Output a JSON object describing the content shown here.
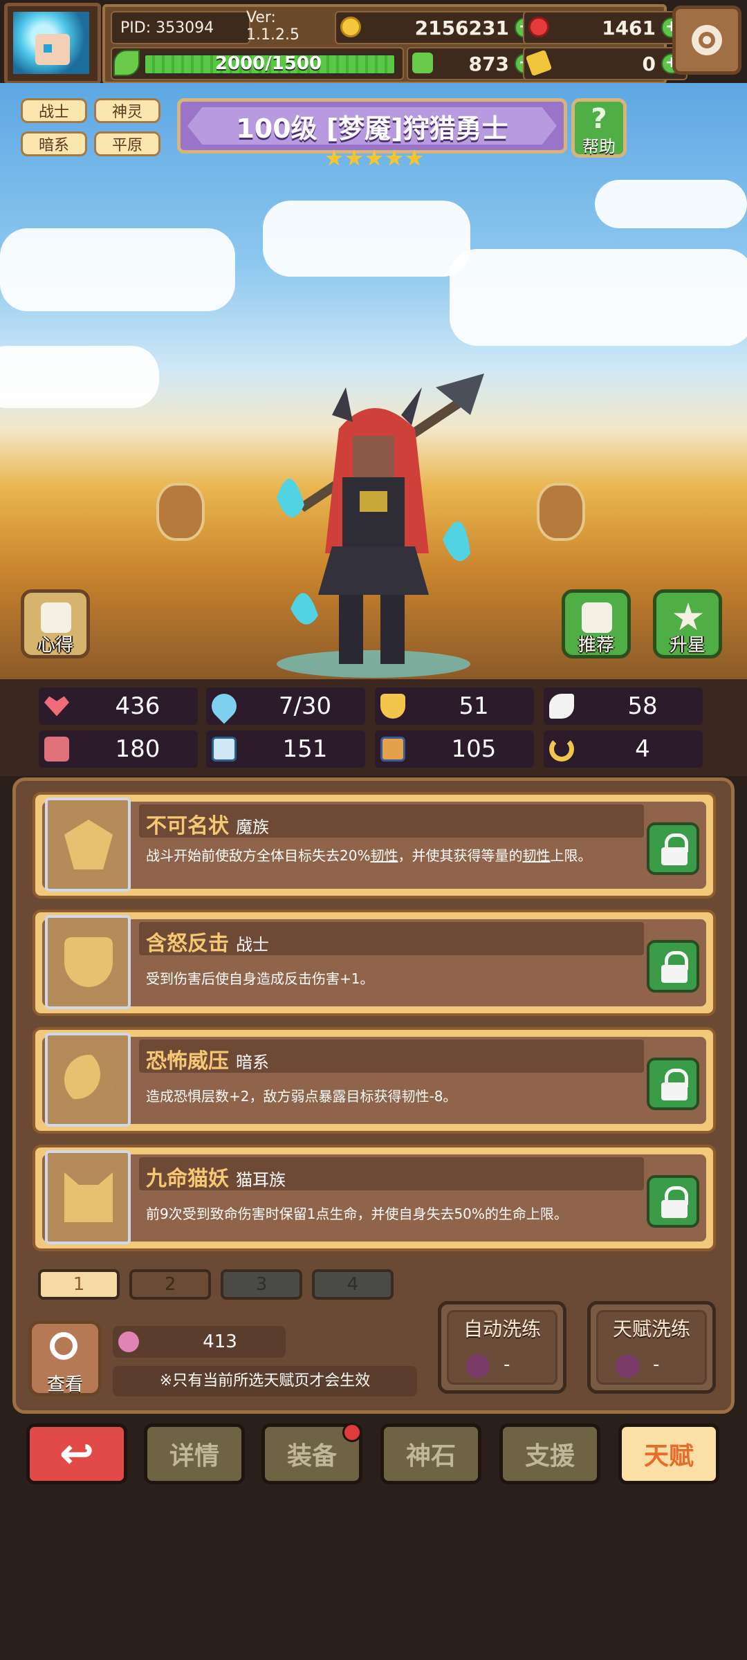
{
  "hud": {
    "pid": "PID: 353094",
    "version": "Ver: 1.1.2.5",
    "gold": "2156231",
    "gems": "1461",
    "energy": "2000/1500",
    "energy_fraction": 1.0,
    "clover": "873",
    "tickets": "0"
  },
  "tags": [
    "战士",
    "神灵",
    "暗系",
    "平原"
  ],
  "hero": {
    "title": "100级 [梦魇]狩猎勇士",
    "stars": 5
  },
  "buttons": {
    "help": "帮助",
    "notes": "心得",
    "recommend": "推荐",
    "star_up": "升星"
  },
  "stats": [
    {
      "icon": "heart-icon",
      "value": "436"
    },
    {
      "icon": "mana-drop-icon",
      "value": "7/30"
    },
    {
      "icon": "shield-icon",
      "value": "51"
    },
    {
      "icon": "wing-icon",
      "value": "58"
    },
    {
      "icon": "fist-icon",
      "value": "180"
    },
    {
      "icon": "book-icon",
      "value": "151"
    },
    {
      "icon": "boot-icon",
      "value": "105"
    },
    {
      "icon": "horseshoe-icon",
      "value": "4"
    }
  ],
  "talents": [
    {
      "name": "不可名状",
      "category": "魔族",
      "desc_html": "战斗开始前使敌方全体目标失去20%<span class='ul'>韧性</span>，并使其获得等量的<span class='ul'>韧性</span>上限。",
      "desc": "战斗开始前使敌方全体目标失去20%韧性，并使其获得等量的韧性上限。"
    },
    {
      "name": "含怒反击",
      "category": "战士",
      "desc": "受到伤害后使自身造成反击伤害+1。"
    },
    {
      "name": "恐怖威压",
      "category": "暗系",
      "desc": "造成恐惧层数+2，敌方弱点暴露目标获得韧性-8。"
    },
    {
      "name": "九命猫妖",
      "category": "猫耳族",
      "desc": "前9次受到致命伤害时保留1点生命，并使自身失去50%的生命上限。"
    }
  ],
  "pages": [
    "1",
    "2",
    "3",
    "4"
  ],
  "panel": {
    "view_label": "查看",
    "fruit_count": "413",
    "note": "※只有当前所选天赋页才会生效",
    "auto_wash": "自动洗练",
    "talent_wash": "天赋洗练",
    "auto_wash_cost": "-",
    "talent_wash_cost": "-"
  },
  "nav": {
    "back": "↩",
    "details": "详情",
    "equipment": "装备",
    "godstone": "神石",
    "support": "支援",
    "talent": "天赋"
  },
  "colors": {
    "title_purple": "#9a74c8",
    "active_tab": "#fbe0a6",
    "back_red": "#e24a4a",
    "lock_green": "#3a9c48"
  }
}
